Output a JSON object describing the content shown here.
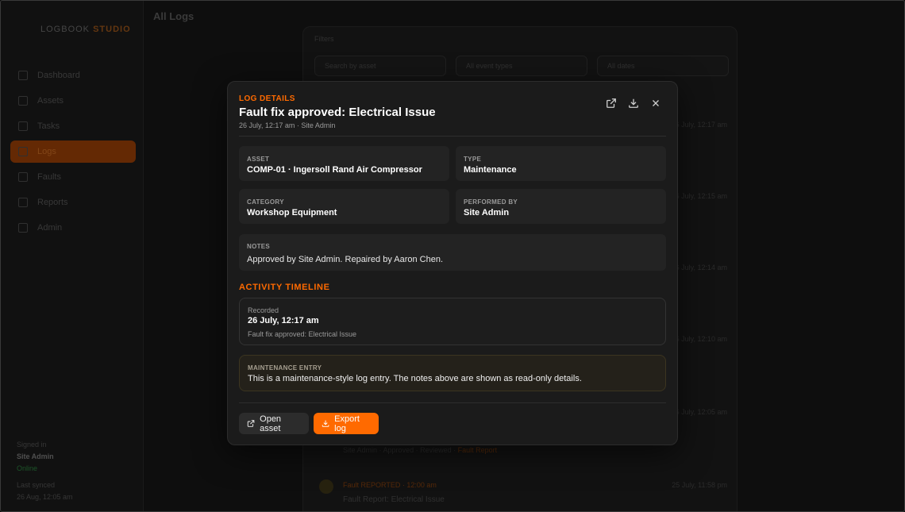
{
  "background": {
    "page_title": "All Logs",
    "logo": {
      "first": "LOGBOOK",
      "second": "STUDIO"
    },
    "nav": [
      "Dashboard",
      "Assets",
      "Tasks",
      "Logs",
      "Faults",
      "Reports",
      "Admin"
    ],
    "filter_label": "Filters",
    "filters": [
      "Search by asset",
      "All event types",
      "All dates"
    ],
    "times": [
      "26 July, 12:17 am",
      "26 July, 12:15 am",
      "26 July, 12:14 am",
      "26 July, 12:10 am",
      "26 July, 12:05 am",
      "25 July, 11:58 pm"
    ],
    "tags": [
      "Site Admin",
      "Approved",
      "Reviewed",
      "Fault Report"
    ],
    "entry_title": "Fault REPORTED",
    "entry_time": "12:00 am",
    "entry_sub": "Fault Report: Electrical Issue",
    "footer": {
      "label": "Signed in",
      "user": "Site Admin",
      "status": "Online",
      "label2": "Last synced",
      "time": "26 Aug, 12:05 am"
    }
  },
  "modal": {
    "eyebrow": "LOG DETAILS",
    "title": "Fault fix approved: Electrical Issue",
    "subtitle": "26 July, 12:17 am · Site Admin",
    "fields": {
      "asset": {
        "label": "ASSET",
        "value": "COMP-01 · Ingersoll Rand Air Compressor"
      },
      "type": {
        "label": "TYPE",
        "value": "Maintenance"
      },
      "category": {
        "label": "CATEGORY",
        "value": "Workshop Equipment"
      },
      "performed_by": {
        "label": "PERFORMED BY",
        "value": "Site Admin"
      }
    },
    "notes": {
      "label": "NOTES",
      "value": "Approved by Site Admin. Repaired by Aaron Chen."
    },
    "timeline": {
      "title": "ACTIVITY TIMELINE",
      "label": "Recorded",
      "date": "26 July, 12:17 am",
      "description": "Fault fix approved: Electrical Issue"
    },
    "maintenance": {
      "label": "MAINTENANCE ENTRY",
      "text": "This is a maintenance-style log entry. The notes above are shown as read-only details."
    },
    "buttons": {
      "open_asset": "Open asset",
      "export_log": "Export log"
    }
  },
  "colors": {
    "accent": "#ff6a00",
    "modal_bg": "#1b1b1b",
    "card_bg": "#232323"
  },
  "icons": [
    "external-link-icon",
    "download-icon",
    "close-icon"
  ]
}
